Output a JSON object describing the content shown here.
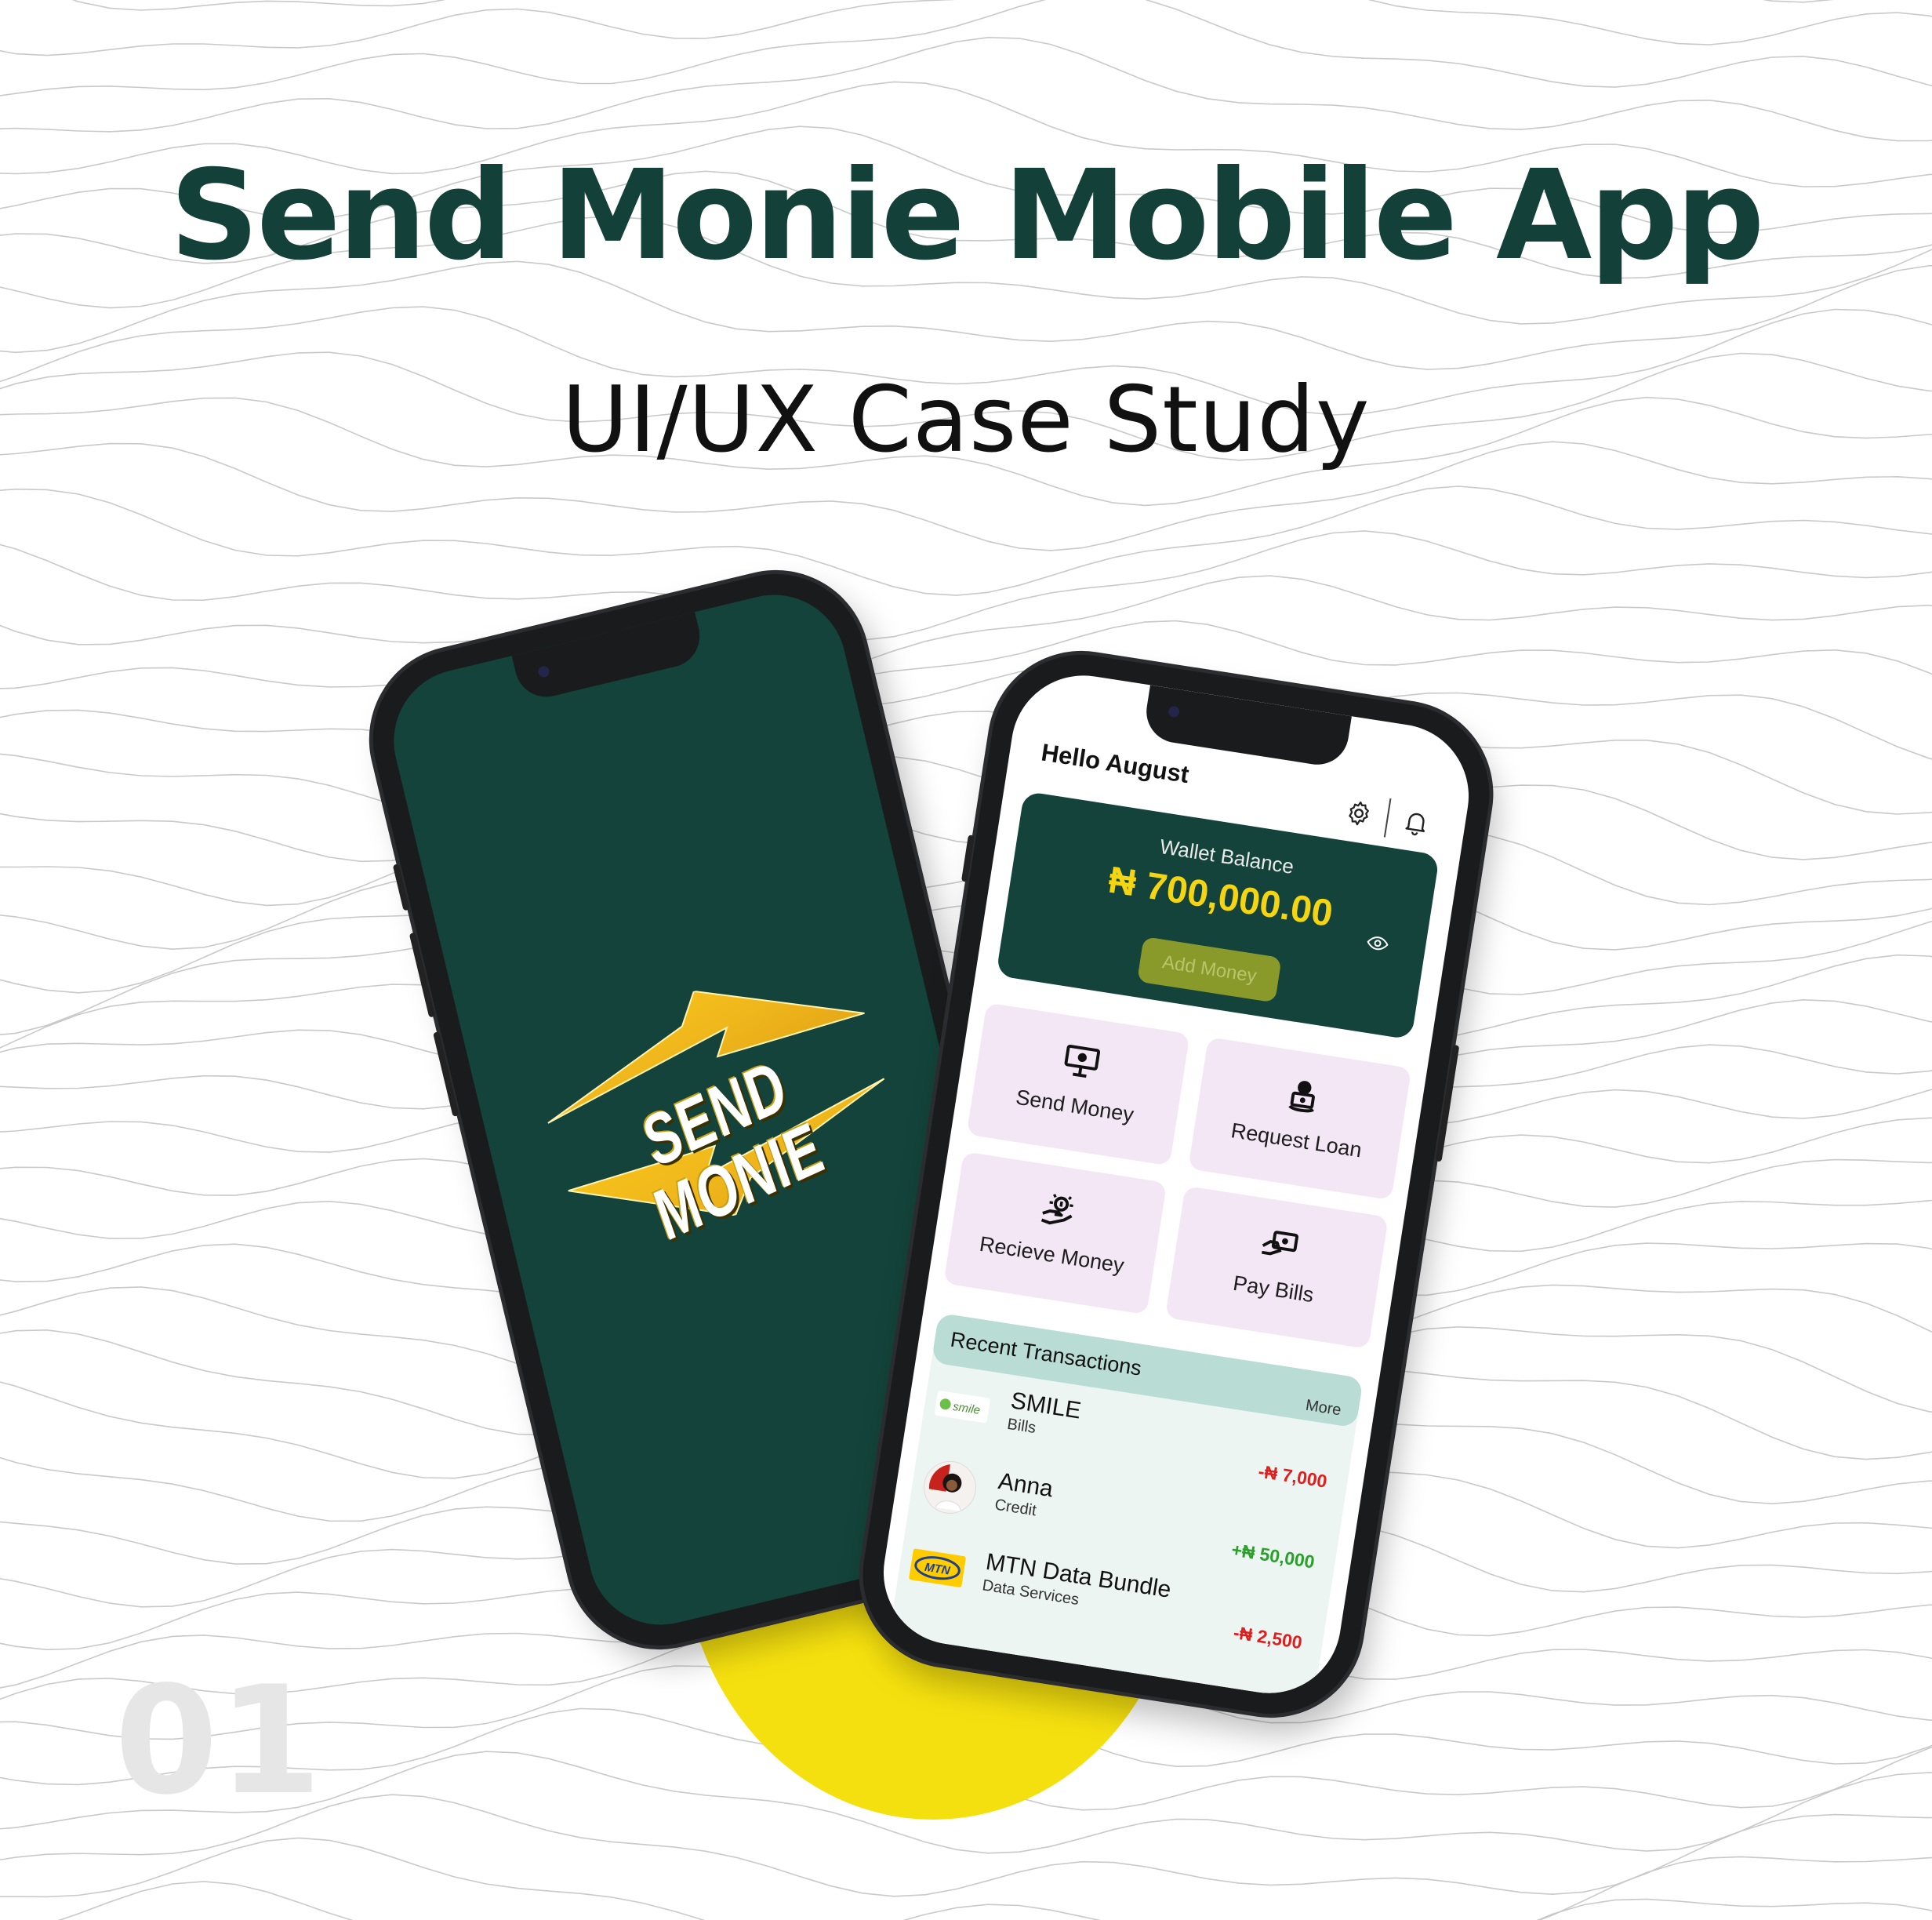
{
  "header": {
    "title": "Send Monie Mobile App",
    "subtitle": "UI/UX Case Study"
  },
  "page_number": "01",
  "colors": {
    "brand_green": "#13433a",
    "accent_yellow": "#f5e00f",
    "amount_yellow": "#f3d511",
    "debit_red": "#e01e1e",
    "credit_green": "#2aa02a"
  },
  "splash": {
    "logo_text": "SEND MONIE"
  },
  "dashboard": {
    "greeting": "Hello August",
    "icons": {
      "settings": "gear-icon",
      "notifications": "bell-icon"
    },
    "wallet": {
      "label": "Wallet Balance",
      "amount": "₦ 700,000.00",
      "add_money_label": "Add Money"
    },
    "actions": [
      {
        "label": "Send Money",
        "icon": "send-money-icon"
      },
      {
        "label": "Request Loan",
        "icon": "request-loan-icon"
      },
      {
        "label": "Recieve Money",
        "icon": "receive-money-icon"
      },
      {
        "label": "Pay Bills",
        "icon": "pay-bills-icon"
      }
    ],
    "recent": {
      "title": "Recent Transactions",
      "more_label": "More",
      "transactions": [
        {
          "name": "SMILE",
          "type": "Bills",
          "amount": "-₦ 7,000",
          "logo_text": "smile",
          "kind": "debit"
        },
        {
          "name": "Anna",
          "type": "Credit",
          "amount": "+₦ 50,000",
          "logo_text": "",
          "kind": "credit"
        },
        {
          "name": "MTN Data Bundle",
          "type": "Data Services",
          "amount": "-₦ 2,500",
          "logo_text": "MTN",
          "kind": "debit"
        }
      ]
    }
  }
}
